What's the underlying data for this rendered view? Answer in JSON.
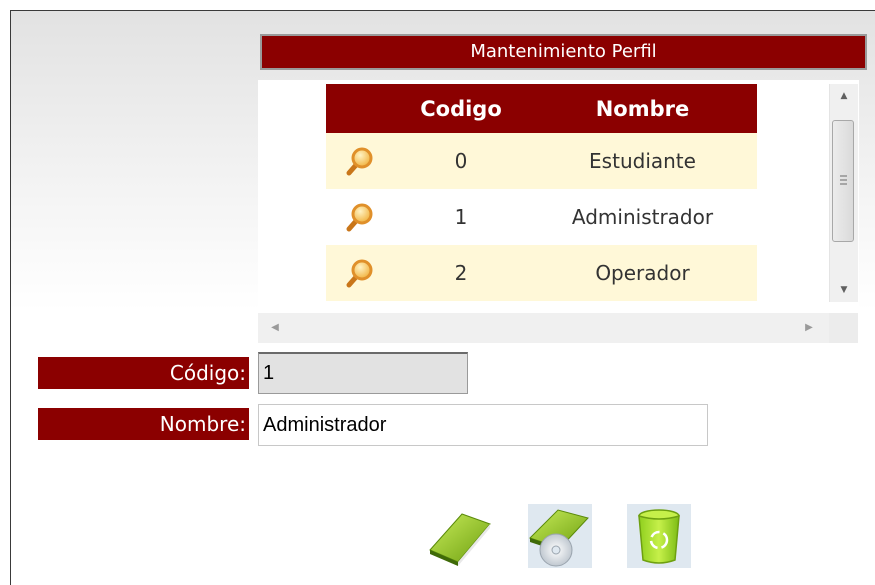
{
  "title": "Mantenimiento Perfil",
  "grid": {
    "columns": [
      "",
      "Codigo",
      "Nombre"
    ],
    "rows": [
      {
        "codigo": "0",
        "nombre": "Estudiante"
      },
      {
        "codigo": "1",
        "nombre": "Administrador"
      },
      {
        "codigo": "2",
        "nombre": "Operador"
      }
    ],
    "select_icon": "magnifier-icon"
  },
  "form": {
    "codigo_label": "Código:",
    "codigo_value": "1",
    "nombre_label": "Nombre:",
    "nombre_value": "Administrador"
  },
  "actions": [
    {
      "name": "new-button",
      "icon": "book-icon"
    },
    {
      "name": "save-button",
      "icon": "book-disc-icon"
    },
    {
      "name": "delete-button",
      "icon": "recycle-bin-icon"
    }
  ],
  "colors": {
    "header_bg": "#8b0000",
    "header_text": "#ffffff",
    "row_alt_bg": "#fff8d8",
    "icon_green": "#9ccc1c"
  }
}
